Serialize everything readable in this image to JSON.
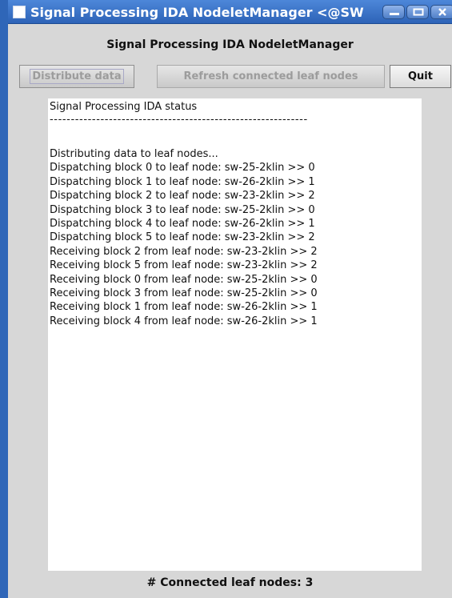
{
  "window": {
    "title": "Signal Processing IDA NodeletManager <@SW"
  },
  "app": {
    "heading": "Signal Processing IDA NodeletManager"
  },
  "toolbar": {
    "distribute_label": "Distribute data",
    "refresh_label": "Refresh connected leaf nodes",
    "quit_label": "Quit"
  },
  "status": {
    "title": "Signal Processing IDA status",
    "rule": "-------------------------------------------------------------",
    "lines": [
      "Distributing data to leaf nodes...",
      "Dispatching block 0 to leaf node: sw-25-2klin >> 0",
      "Dispatching block 1 to leaf node: sw-26-2klin >> 1",
      "Dispatching block 2 to leaf node: sw-23-2klin >> 2",
      "Dispatching block 3 to leaf node: sw-25-2klin >> 0",
      "Dispatching block 4 to leaf node: sw-26-2klin >> 1",
      "Dispatching block 5 to leaf node: sw-23-2klin >> 2",
      "Receiving block 2 from leaf node: sw-23-2klin >> 2",
      "Receiving block 5 from leaf node: sw-23-2klin >> 2",
      "Receiving block 0 from leaf node: sw-25-2klin >> 0",
      "Receiving block 3 from leaf node: sw-25-2klin >> 0",
      "Receiving block 1 from leaf node: sw-26-2klin >> 1",
      "Receiving block 4 from leaf node: sw-26-2klin >> 1"
    ]
  },
  "footer": {
    "connected_label": "# Connected leaf nodes: 3"
  },
  "icons": {
    "minimize": "minimize-icon",
    "maximize": "maximize-icon",
    "close": "close-icon"
  },
  "colors": {
    "titlebar": "#2d63b7",
    "content_bg": "#d7d7d7",
    "panel_bg": "#ffffff"
  }
}
